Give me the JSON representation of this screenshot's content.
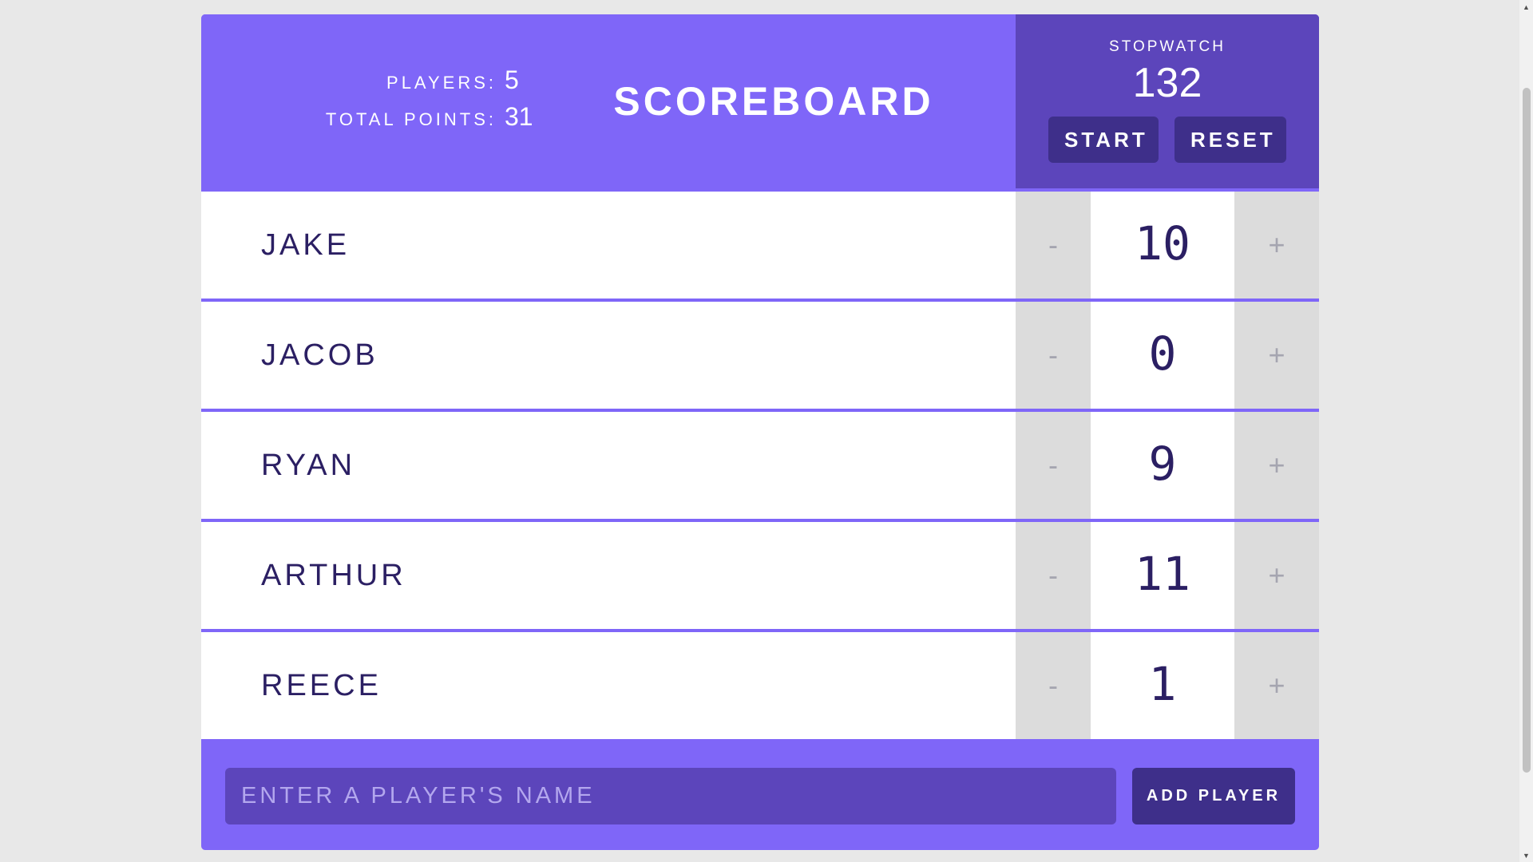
{
  "header": {
    "players_label": "PLAYERS:",
    "players_count": "5",
    "points_label": "TOTAL POINTS:",
    "points_total": "31",
    "title": "SCOREBOARD"
  },
  "stopwatch": {
    "label": "STOPWATCH",
    "time": "132",
    "start_label": "START",
    "reset_label": "RESET"
  },
  "players": [
    {
      "name": "JAKE",
      "score": "10",
      "dec": "-",
      "inc": "+"
    },
    {
      "name": "JACOB",
      "score": "0",
      "dec": "-",
      "inc": "+"
    },
    {
      "name": "RYAN",
      "score": "9",
      "dec": "-",
      "inc": "+"
    },
    {
      "name": "ARTHUR",
      "score": "11",
      "dec": "-",
      "inc": "+"
    },
    {
      "name": "REECE",
      "score": "1",
      "dec": "-",
      "inc": "+"
    }
  ],
  "form": {
    "placeholder": "ENTER A PLAYER'S NAME",
    "value": "",
    "add_label": "ADD PLAYER"
  },
  "scrollbar": {
    "up_icon": "▲",
    "down_icon": "▼"
  },
  "colors": {
    "primary": "#7f66f8",
    "dark": "#5c45bb",
    "button": "#3e2f8a",
    "text": "#2b1f63"
  }
}
